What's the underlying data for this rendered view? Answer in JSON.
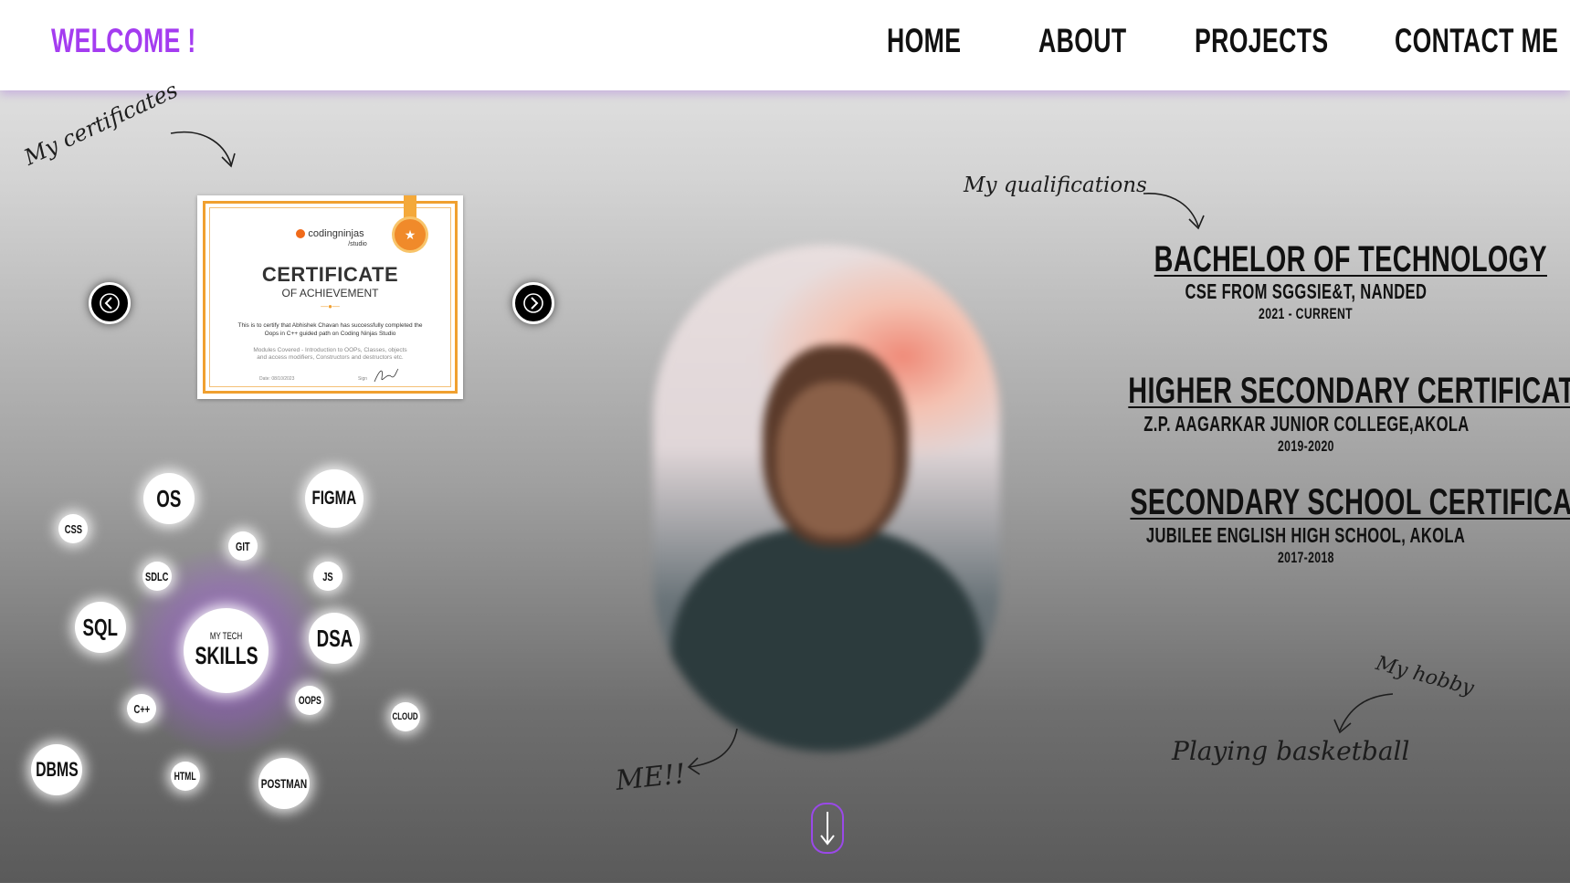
{
  "header": {
    "brand": "WELCOME !",
    "nav": [
      "HOME",
      "ABOUT",
      "PROJECTS",
      "CONTACT ME"
    ]
  },
  "certificates": {
    "label": "My certificates",
    "current": {
      "issuer": "codingninjas",
      "issuer_sub": "/studio",
      "title": "CERTIFICATE",
      "subtitle": "OF ACHIEVEMENT",
      "body": "This is to certify that Abhishek Chavan has successfully completed the Oops in C++ guided path on Coding Ninjas Studio",
      "modules": "Modules Covered - Introduction to OOPs, Classes, objects and access modifiers, Constructors and destructors etc.",
      "date": "Date: 08/10/2023",
      "sign": "Sign"
    }
  },
  "skills": {
    "center_small": "MY TECH",
    "center_big": "SKILLS",
    "items": [
      "OS",
      "FIGMA",
      "CSS",
      "GIT",
      "SDLC",
      "JS",
      "SQL",
      "DSA",
      "C++",
      "OOPS",
      "CLOUD",
      "DBMS",
      "HTML",
      "POSTMAN"
    ]
  },
  "me_label": "ME!!",
  "qualifications": {
    "label": "My qualifications",
    "items": [
      {
        "title": "BACHELOR OF TECHNOLOGY",
        "sub": "CSE FROM SGGSIE&T, NANDED",
        "years": "2021 - CURRENT"
      },
      {
        "title": "HIGHER SECONDARY CERTIFICATION",
        "sub": "Z.P. AAGARKAR JUNIOR COLLEGE,AKOLA",
        "years": "2019-2020"
      },
      {
        "title": "SECONDARY SCHOOL CERTIFICATION",
        "sub": "JUBILEE ENGLISH HIGH SCHOOL, AKOLA",
        "years": "2017-2018"
      }
    ]
  },
  "hobby": {
    "label": "My hobby",
    "value": "Playing basketball"
  },
  "colors": {
    "accent": "#a43cf0",
    "cert_border": "#f0a030"
  },
  "icons": {
    "prev": "chevron-left-icon",
    "next": "chevron-right-icon",
    "scroll": "arrow-down-icon"
  }
}
